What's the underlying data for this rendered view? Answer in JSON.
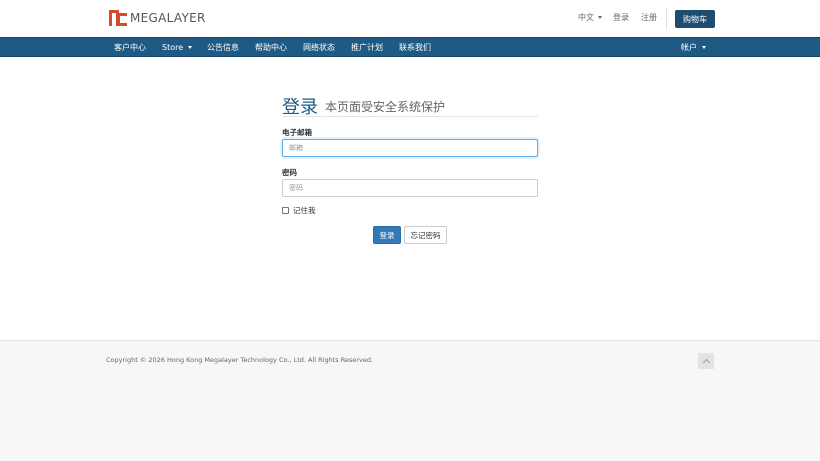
{
  "brand": {
    "name": "MEGALAYER"
  },
  "header": {
    "language": "中文",
    "login": "登录",
    "register": "注册",
    "cart": "购物车"
  },
  "nav": {
    "items": [
      {
        "label": "客户中心"
      },
      {
        "label": "Store"
      },
      {
        "label": "公告信息"
      },
      {
        "label": "帮助中心"
      },
      {
        "label": "网络状态"
      },
      {
        "label": "推广计划"
      },
      {
        "label": "联系我们"
      }
    ],
    "account": "帐户"
  },
  "login_form": {
    "title": "登录",
    "subtitle": "本页面受安全系统保护",
    "email_label": "电子邮箱",
    "email_placeholder": "邮箱",
    "password_label": "密码",
    "password_placeholder": "密码",
    "remember_label": "记住我",
    "submit_label": "登录",
    "forgot_label": "忘记密码"
  },
  "footer": {
    "copyright": "Copyright © 2026 Hong Kong Megalayer Technology Co., Ltd. All Rights Reserved."
  },
  "colors": {
    "nav_bg": "#1f5a85",
    "primary_button": "#337ab7",
    "cart_button": "#1e4d72",
    "logo_red": "#d94a2b"
  }
}
